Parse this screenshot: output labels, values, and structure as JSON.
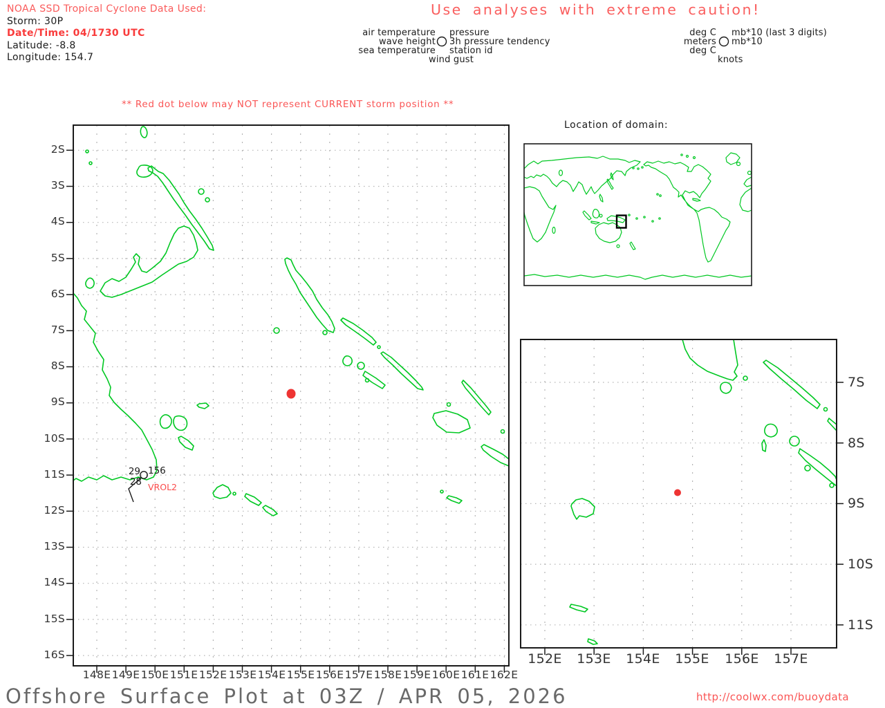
{
  "header": {
    "line1": "NOAA SSD Tropical Cyclone Data Used:",
    "line2": "Storm: 30P",
    "line3": "Date/Time: 04/1730 UTC",
    "line4": "Latitude: -8.8",
    "line5": "Longitude: 154.7"
  },
  "caution": "Use analyses with extreme caution!",
  "warning": "** Red dot below may NOT represent CURRENT storm position **",
  "legend_center": {
    "col1": [
      "air temperature",
      "wave height",
      "sea temperature"
    ],
    "col2": [
      "pressure",
      "3h pressure tendency",
      "station id"
    ],
    "bottom": "wind gust",
    "symbol": "station-circle"
  },
  "legend_right": {
    "col1": [
      "deg C",
      "meters",
      "deg C"
    ],
    "col2": [
      "mb*10 (last 3 digits)",
      "mb*10"
    ],
    "bottom": "knots",
    "symbol": "station-circle"
  },
  "inset": {
    "title": "Location of domain:"
  },
  "main_map": {
    "lat_labels": [
      "2S",
      "3S",
      "4S",
      "5S",
      "6S",
      "7S",
      "8S",
      "9S",
      "10S",
      "11S",
      "12S",
      "13S",
      "14S",
      "15S",
      "16S"
    ],
    "lon_labels": [
      "148E",
      "149E",
      "150E",
      "151E",
      "152E",
      "153E",
      "154E",
      "155E",
      "156E",
      "157E",
      "158E",
      "159E",
      "160E",
      "161E",
      "162E"
    ],
    "station": {
      "air_temp": "29",
      "sea_temp": "28",
      "pressure": "156",
      "id": "VROL2"
    },
    "storm_dot": {
      "lat": -8.8,
      "lon": 154.7
    }
  },
  "zoom_map": {
    "lon_labels": [
      "152E",
      "153E",
      "154E",
      "155E",
      "156E",
      "157E"
    ],
    "lat_labels": [
      "7S",
      "8S",
      "9S",
      "10S",
      "11S"
    ],
    "storm_dot": {
      "lat": -8.8,
      "lon": 154.7
    }
  },
  "footer": {
    "title": "Offshore Surface Plot at 03Z / APR 05, 2026",
    "url": "http://coolwx.com/buoydata"
  },
  "colors": {
    "coastline": "#00c822",
    "red_text": "#fa5a5a",
    "storm_dot": "#ee3433",
    "grid": "#b4b4b4"
  }
}
